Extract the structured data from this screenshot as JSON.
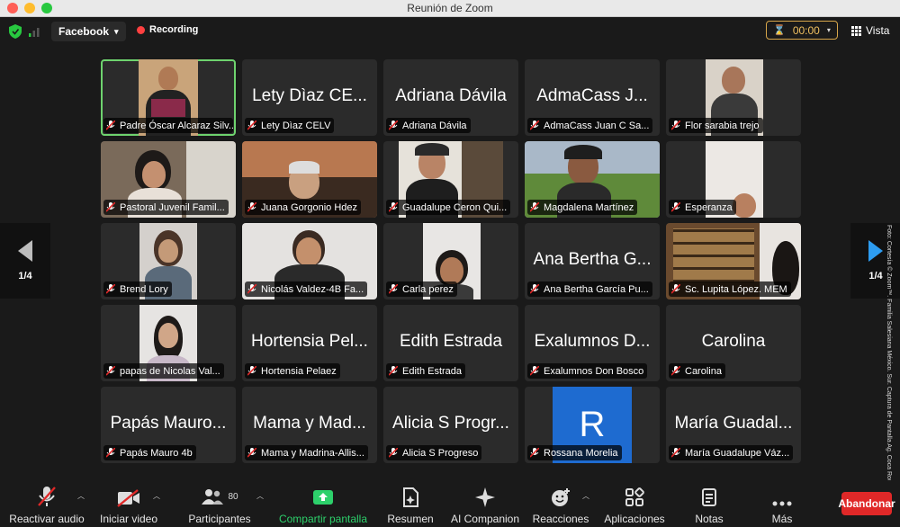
{
  "window": {
    "title": "Reunión de Zoom"
  },
  "topbar": {
    "stream": "Facebook",
    "recording": "Recording",
    "timer": "00:00",
    "view": "Vista"
  },
  "nav": {
    "page": "1/4"
  },
  "tiles": [
    {
      "name": "",
      "label": "Padre Óscar Alcaraz Silv..."
    },
    {
      "name": "Lety Dìaz CE...",
      "label": "Lety Dìaz CELV"
    },
    {
      "name": "Adriana Dávila",
      "label": "Adriana Dávila"
    },
    {
      "name": "AdmaCass J...",
      "label": "AdmaCass Juan C Sa..."
    },
    {
      "name": "",
      "label": "Flor sarabia trejo"
    },
    {
      "name": "",
      "label": "Pastoral Juvenil Famil..."
    },
    {
      "name": "",
      "label": "Juana Gorgonio Hdez"
    },
    {
      "name": "",
      "label": "Guadalupe Ceron Qui..."
    },
    {
      "name": "",
      "label": "Magdalena Martínez"
    },
    {
      "name": "",
      "label": "Esperanza"
    },
    {
      "name": "",
      "label": "Brend Lory"
    },
    {
      "name": "",
      "label": "Nicolás Valdez-4B Fa..."
    },
    {
      "name": "",
      "label": "Carla perez"
    },
    {
      "name": "Ana Bertha G...",
      "label": "Ana Bertha García Pu..."
    },
    {
      "name": "",
      "label": "Sc. Lupita López. MEM"
    },
    {
      "name": "",
      "label": "papas de Nicolas Val..."
    },
    {
      "name": "Hortensia Pel...",
      "label": "Hortensia Pelaez"
    },
    {
      "name": "Edith Estrada",
      "label": "Edith Estrada"
    },
    {
      "name": "Exalumnos D...",
      "label": "Exalumnos Don Bosco"
    },
    {
      "name": "Carolina",
      "label": "Carolina"
    },
    {
      "name": "Papás Mauro...",
      "label": "Papás Mauro 4b"
    },
    {
      "name": "Mama y Mad...",
      "label": "Mama y Madrina-Allis..."
    },
    {
      "name": "Alicia S Progr...",
      "label": "Alicia S Progreso"
    },
    {
      "name": "R",
      "label": "Rossana Morelia"
    },
    {
      "name": "María Guadal...",
      "label": "María Guadalupe Váz..."
    }
  ],
  "toolbar": {
    "audio": "Reactivar audio",
    "video": "Iniciar video",
    "participants": "Participantes",
    "participants_count": "80",
    "share": "Compartir pantalla",
    "summary": "Resumen",
    "companion": "AI Companion",
    "reactions": "Reacciones",
    "apps": "Aplicaciones",
    "notes": "Notas",
    "more": "Más",
    "leave": "Abandonar"
  },
  "watermark": "Foto: Cortesía © Zoom™. Familia Salesiana México. Sur. Captura de Pantalla Ag. Coca Roura",
  "colors": {
    "share": "#2dd06b",
    "leave": "#e02828",
    "timer": "#d7a64a",
    "active": "#6ed36e"
  }
}
